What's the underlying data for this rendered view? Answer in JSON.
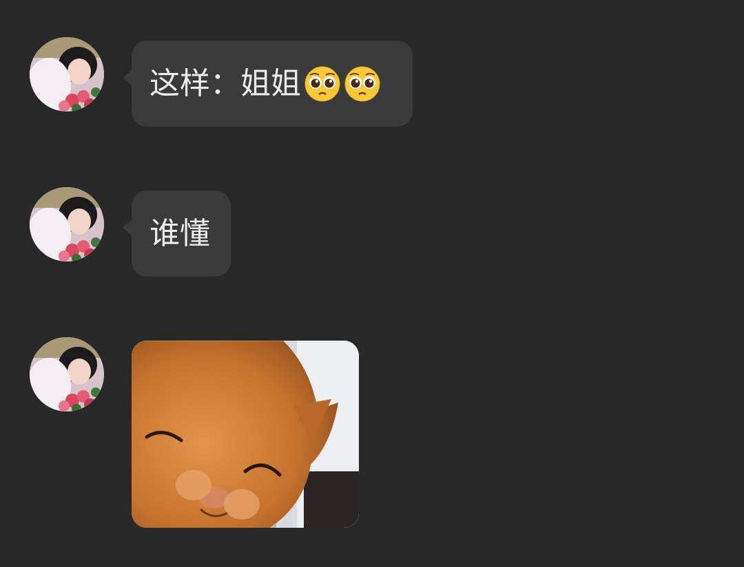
{
  "messages": [
    {
      "type": "text",
      "text": "这样：姐姐",
      "emojis": [
        "pleading-face-emoji",
        "pleading-face-emoji"
      ]
    },
    {
      "type": "text",
      "text": "谁懂",
      "emojis": []
    },
    {
      "type": "image",
      "image_subject": "smiling-orange-cat-sticker"
    }
  ],
  "colors": {
    "background": "#282828",
    "bubble": "#3a3a3a",
    "text": "#ececec"
  }
}
